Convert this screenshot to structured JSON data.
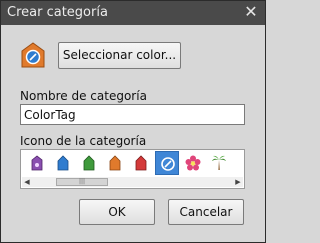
{
  "window": {
    "title": "Crear categoría",
    "close_glyph": "✕"
  },
  "color": {
    "select_button_label": "Seleccionar color...",
    "current_icon": "color-tag-icon",
    "accent": "#3f86d6"
  },
  "name_field": {
    "label": "Nombre de categoría",
    "value": "ColorTag"
  },
  "icon_picker": {
    "label": "Icono de la categoría",
    "icons": [
      {
        "name": "purple-tag-icon",
        "color": "#8a4fb0"
      },
      {
        "name": "blue-house-icon",
        "color": "#2f7ccf"
      },
      {
        "name": "green-house-icon",
        "color": "#3f9a3c"
      },
      {
        "name": "orange-house-icon",
        "color": "#e07a2c"
      },
      {
        "name": "red-house-icon",
        "color": "#d43a3a"
      },
      {
        "name": "color-tag-icon",
        "color": "#ffffff",
        "selected": true
      },
      {
        "name": "flower-icon",
        "color": "#e0457a"
      },
      {
        "name": "palm-tree-icon",
        "color": "#3f8a2e"
      }
    ],
    "scroll_thumb_glyph": "|||"
  },
  "buttons": {
    "ok_label": "OK",
    "cancel_label": "Cancelar"
  }
}
